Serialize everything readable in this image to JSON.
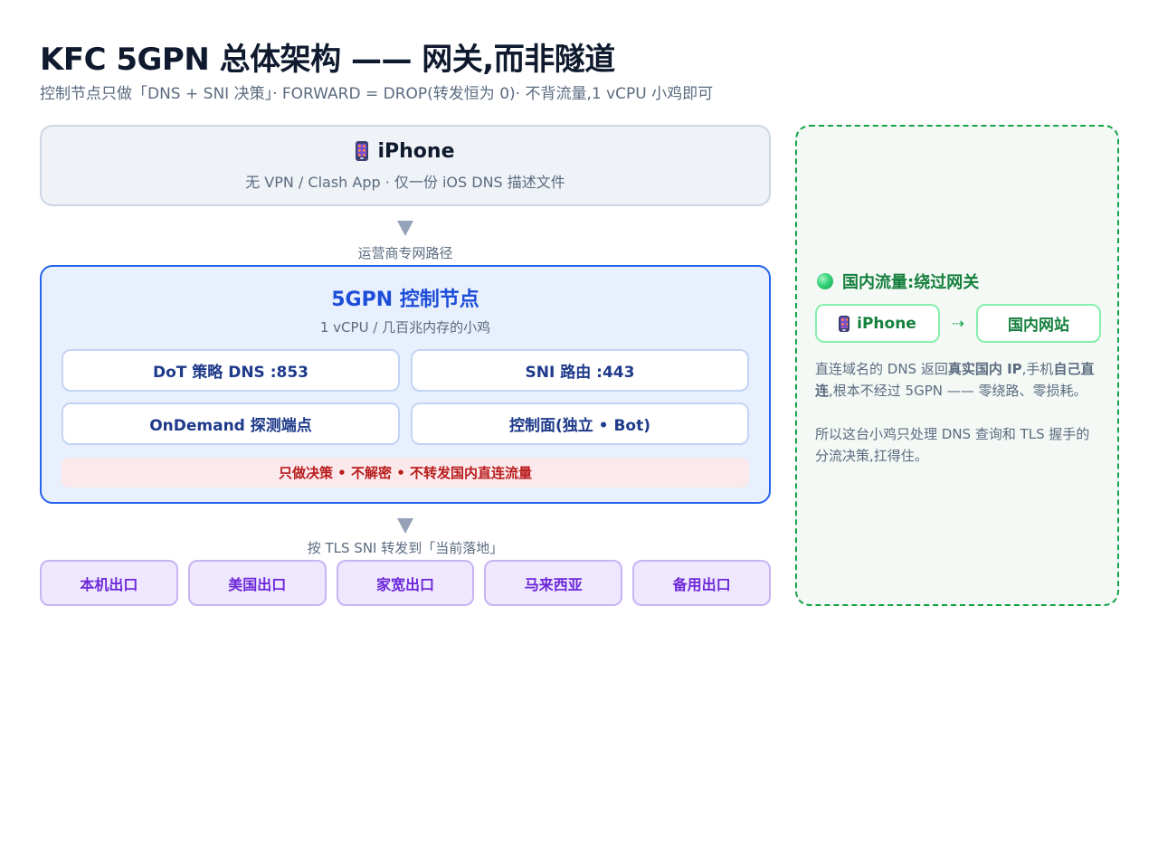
{
  "header": {
    "title": "KFC 5GPN 总体架构 —— 网关,而非隧道",
    "subtitle": "控制节点只做「DNS + SNI 决策」· FORWARD = DROP(转发恒为 0)· 不背流量,1 vCPU 小鸡即可"
  },
  "client": {
    "icon": "phone-icon",
    "title": "iPhone",
    "subtitle": "无 VPN / Clash App · 仅一份 iOS DNS 描述文件"
  },
  "edge_1": {
    "label": "运营商专网路径"
  },
  "control_node": {
    "title": "5GPN 控制节点",
    "subtitle": "1 vCPU / 几百兆内存的小鸡",
    "cells": [
      "DoT 策略 DNS :853",
      "SNI 路由 :443",
      "OnDemand 探测端点",
      "控制面(独立 • Bot)"
    ],
    "note": "只做决策 • 不解密 • 不转发国内直连流量",
    "colors": {
      "border": "#2563eb",
      "note": "#b91c1c"
    }
  },
  "edge_2": {
    "label": "按 TLS SNI 转发到「当前落地」"
  },
  "exits": [
    "本机出口",
    "美国出口",
    "家宽出口",
    "马来西亚",
    "备用出口"
  ],
  "domestic": {
    "heading": "国内流量:绕过网关",
    "from": "iPhone",
    "arrow": "⇢",
    "to": "国内网站",
    "para1": {
      "t1": "直连域名的 DNS 返回",
      "b1": "真实国内 IP",
      "t2": ",手机",
      "b2": "自己直连",
      "t3": ",根本不经过 5GPN —— 零绕路、零损耗。"
    },
    "para2": "所以这台小鸡只处理 DNS 查询和 TLS 握手的分流决策,扛得住。",
    "colors": {
      "accent": "#16a34a"
    }
  }
}
